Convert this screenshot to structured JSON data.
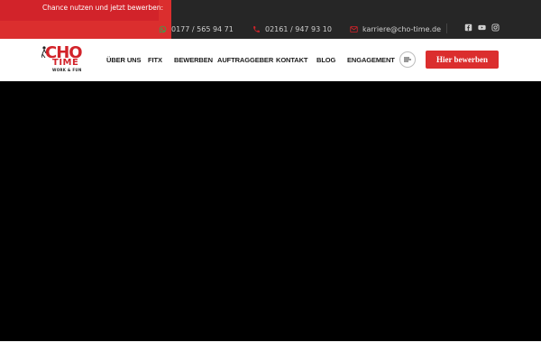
{
  "topbar": {
    "chance_text": "Chance nutzen und jetzt bewerben:",
    "phone_mobile": "0177 / 565 94 71",
    "phone_landline": "02161 / 947 93 10",
    "email": "karriere@cho-time.de",
    "social_icons": [
      "facebook-icon",
      "youtube-icon",
      "instagram-icon"
    ]
  },
  "logo": {
    "main": "CHO",
    "secondary": "TIME",
    "tagline": "WORK & FUN"
  },
  "nav": {
    "items": [
      {
        "label": "ÜBER UNS"
      },
      {
        "label": "FITX"
      },
      {
        "label": "BEWERBEN"
      },
      {
        "label": "AUFTRAGGEBER"
      },
      {
        "label": "KONTAKT"
      },
      {
        "label": "BLOG"
      },
      {
        "label": "ENGAGEMENT"
      }
    ],
    "menu_icon": "menu-lines-icon",
    "cta_label": "Hier bewerben"
  },
  "colors": {
    "brand_red": "#db2e2e",
    "topbar_bg": "#262626",
    "hero_bg": "#000000"
  }
}
